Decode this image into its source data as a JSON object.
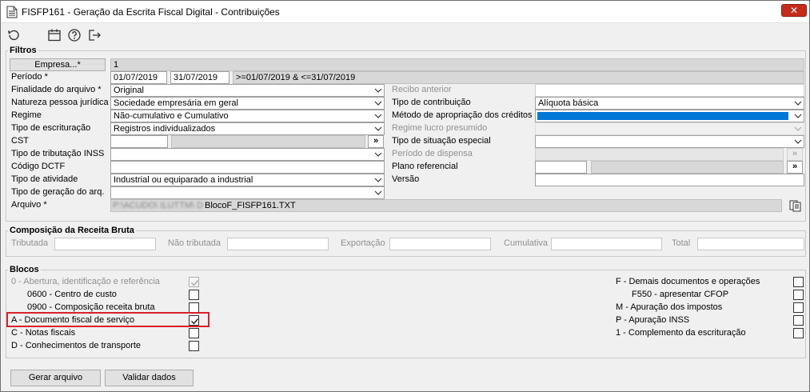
{
  "window": {
    "title": "FISFP161 - Geração da Escrita Fiscal Digital - Contribuições",
    "close_label": "✕"
  },
  "toolbar": {
    "icons": [
      "undo-icon",
      "calendar-icon",
      "help-icon",
      "exit-icon"
    ]
  },
  "filtros": {
    "title": "Filtros",
    "empresa_button": "Empresa...*",
    "empresa_value": "1",
    "periodo_label": "Período *",
    "periodo_start": "01/07/2019",
    "periodo_end": "31/07/2019",
    "periodo_expr": ">=01/07/2019 & <=31/07/2019",
    "finalidade_label": "Finalidade do arquivo *",
    "finalidade_value": "Original",
    "recibo_label": "Recibo anterior",
    "natureza_label": "Natureza pessoa jurídica",
    "natureza_value": "Sociedade empresária em geral",
    "tipo_contribuicao_label": "Tipo de contribuição",
    "tipo_contribuicao_value": "Alíquota básica",
    "regime_label": "Regime",
    "regime_value": "Não-cumulativo e Cumulativo",
    "metodo_label": "Método de apropriação dos créditos",
    "metodo_value": "",
    "tipo_escrituracao_label": "Tipo de escrituração",
    "tipo_escrituracao_value": "Registros individualizados",
    "regime_lucro_label": "Regime lucro presumido",
    "cst_label": "CST",
    "cst_button": "»",
    "tipo_situacao_label": "Tipo de situação especial",
    "tipo_tributacao_label": "Tipo de tributação INSS",
    "periodo_dispensa_label": "Período de dispensa",
    "periodo_dispensa_button": "»",
    "codigo_dctf_label": "Código DCTF",
    "plano_label": "Plano referencial",
    "plano_button": "»",
    "tipo_atividade_label": "Tipo de atividade",
    "tipo_atividade_value": "Industrial ou equiparado a industrial",
    "versao_label": "Versão",
    "tipo_geracao_label": "Tipo de geração do arq.",
    "arquivo_label": "Arquivo *",
    "arquivo_blurred": "P:\\ACUDO\\ ILUTTM\\ D",
    "arquivo_value": "BlocoF_FISFP161.TXT"
  },
  "composicao": {
    "title": "Composição da Receita Bruta",
    "tributada": "Tributada",
    "nao_tributada": "Não tributada",
    "exportacao": "Exportação",
    "cumulativa": "Cumulativa",
    "total": "Total"
  },
  "blocos": {
    "title": "Blocos",
    "left": [
      {
        "label": "0 - Abertura, identificação e referência",
        "checked": true,
        "disabled": true
      },
      {
        "label": "0600 - Centro de custo",
        "checked": false,
        "disabled": false
      },
      {
        "label": "0900 - Composição receita bruta",
        "checked": false,
        "disabled": false
      },
      {
        "label": "A - Documento fiscal de serviço",
        "checked": true,
        "disabled": false
      },
      {
        "label": "C - Notas fiscais",
        "checked": false,
        "disabled": false
      },
      {
        "label": "D - Conhecimentos de transporte",
        "checked": false,
        "disabled": false
      }
    ],
    "right": [
      {
        "label": "F - Demais documentos e operações",
        "checked": false
      },
      {
        "label": "F550 - apresentar CFOP",
        "checked": false
      },
      {
        "label": "M - Apuração dos impostos",
        "checked": false
      },
      {
        "label": "P - Apuração INSS",
        "checked": false
      },
      {
        "label": "1 - Complemento da escrituração",
        "checked": false
      }
    ]
  },
  "actions": {
    "gerar": "Gerar arquivo",
    "validar": "Validar dados"
  },
  "colors": {
    "highlight": "#d9202a",
    "selection": "#0078d7"
  }
}
